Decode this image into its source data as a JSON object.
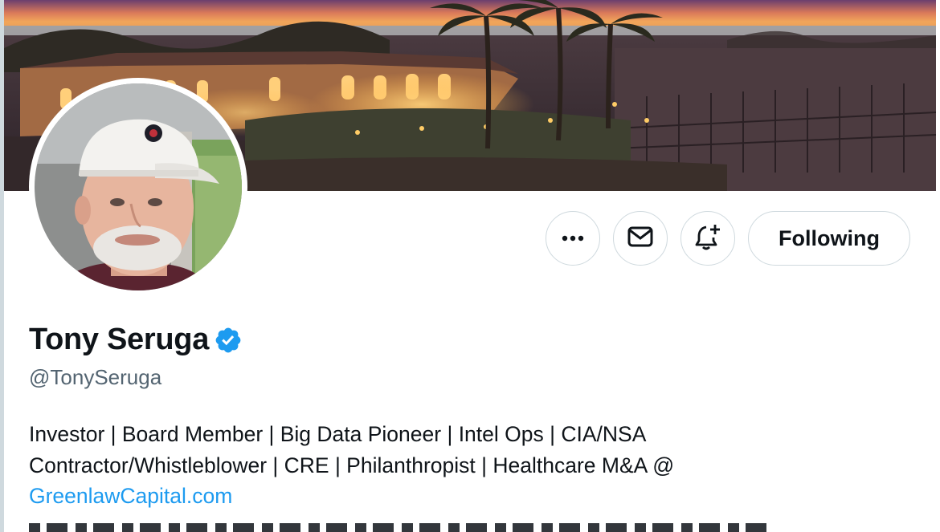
{
  "banner": {
    "description_icon": "banner-image"
  },
  "avatar": {
    "icon": "avatar-photo"
  },
  "actions": {
    "more_icon": "more-horizontal-icon",
    "message_icon": "envelope-icon",
    "notify_icon": "bell-plus-icon",
    "following_label": "Following"
  },
  "profile": {
    "display_name": "Tony Seruga",
    "verified_icon": "verified-badge-icon",
    "handle": "@TonySeruga",
    "bio_line1": "Investor | Board Member | Big Data Pioneer | Intel Ops | CIA/NSA",
    "bio_line2": "Contractor/Whistleblower | CRE | Philanthropist | Healthcare M&A @",
    "bio_link": "GreenlawCapital.com"
  },
  "colors": {
    "text_primary": "#0f1419",
    "text_secondary": "#536471",
    "link": "#1d9bf0",
    "border": "#cfd9de",
    "verified": "#1d9bf0"
  }
}
